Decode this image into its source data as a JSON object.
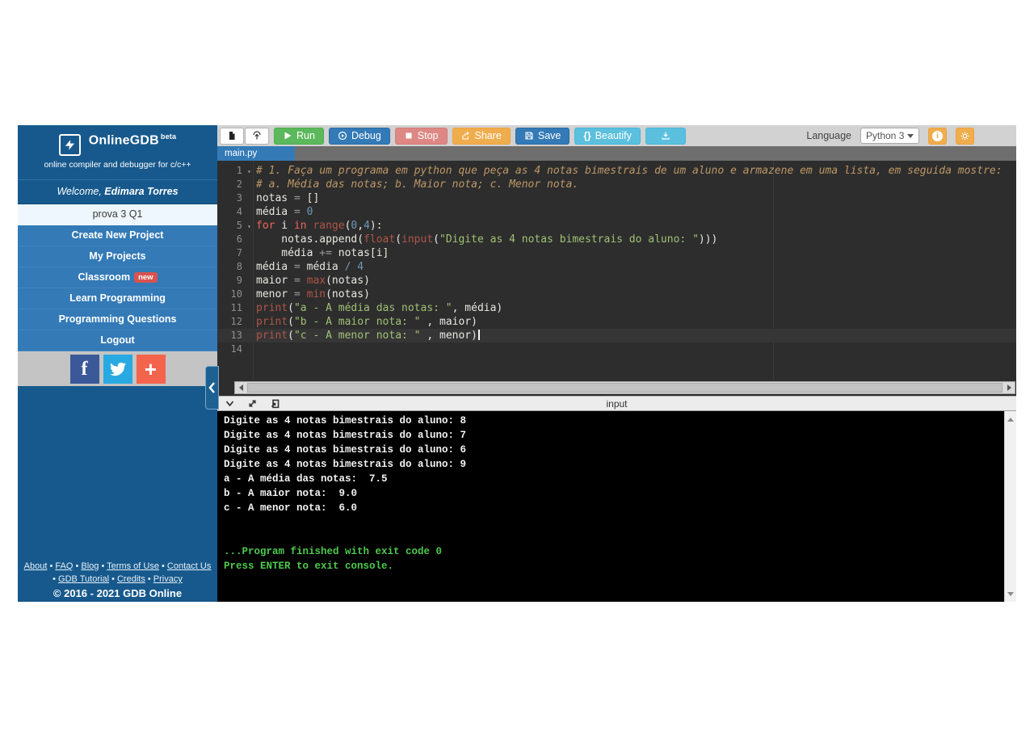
{
  "app": {
    "title": "OnlineGDB",
    "beta": "beta",
    "subtitle": "online compiler and debugger for c/c++"
  },
  "sidebar": {
    "welcome_prefix": "Welcome, ",
    "welcome_name": "Edimara Torres",
    "items": [
      {
        "label": "prova 3 Q1",
        "selected": true
      },
      {
        "label": "Create New Project"
      },
      {
        "label": "My Projects"
      },
      {
        "label": "Classroom",
        "badge": "new"
      },
      {
        "label": "Learn Programming"
      },
      {
        "label": "Programming Questions"
      },
      {
        "label": "Logout"
      }
    ],
    "social": [
      "facebook",
      "twitter",
      "google-plus"
    ],
    "footer_links_row1": [
      "About",
      "FAQ",
      "Blog",
      "Terms of Use",
      "Contact Us"
    ],
    "footer_links_row2": [
      "GDB Tutorial",
      "Credits",
      "Privacy"
    ],
    "copyright": "© 2016 - 2021 GDB Online"
  },
  "toolbar": {
    "run": "Run",
    "debug": "Debug",
    "stop": "Stop",
    "share": "Share",
    "save": "Save",
    "beautify_braces": "{}",
    "beautify": "Beautify",
    "language_label": "Language",
    "language_value": "Python 3"
  },
  "tab": {
    "name": "main.py"
  },
  "editor": {
    "lines": [
      {
        "n": 1,
        "fold": true,
        "tokens": [
          {
            "t": "# 1. Faça um programa em python que peça as 4 notas bimestrais de um aluno e armazene em uma lista, em seguida mostre:",
            "c": "c"
          }
        ]
      },
      {
        "n": 2,
        "tokens": [
          {
            "t": "# a. Média das notas; b. Maior nota; c. Menor nota.",
            "c": "c"
          }
        ]
      },
      {
        "n": 3,
        "tokens": [
          {
            "t": "notas ",
            "c": "v"
          },
          {
            "t": "= ",
            "c": "o"
          },
          {
            "t": "[]",
            "c": "v"
          }
        ]
      },
      {
        "n": 4,
        "tokens": [
          {
            "t": "média ",
            "c": "v"
          },
          {
            "t": "= ",
            "c": "o"
          },
          {
            "t": "0",
            "c": "n"
          }
        ]
      },
      {
        "n": 5,
        "fold": true,
        "tokens": [
          {
            "t": "for",
            "c": "k"
          },
          {
            "t": " i ",
            "c": "v"
          },
          {
            "t": "in",
            "c": "k"
          },
          {
            "t": " ",
            "c": "v"
          },
          {
            "t": "range",
            "c": "b"
          },
          {
            "t": "(",
            "c": "v"
          },
          {
            "t": "0",
            "c": "n"
          },
          {
            "t": ",",
            "c": "v"
          },
          {
            "t": "4",
            "c": "n"
          },
          {
            "t": "):",
            "c": "v"
          }
        ]
      },
      {
        "n": 6,
        "tokens": [
          {
            "t": "    notas.append(",
            "c": "v"
          },
          {
            "t": "float",
            "c": "b"
          },
          {
            "t": "(",
            "c": "v"
          },
          {
            "t": "input",
            "c": "b"
          },
          {
            "t": "(",
            "c": "v"
          },
          {
            "t": "\"Digite as 4 notas bimestrais do aluno: \"",
            "c": "s"
          },
          {
            "t": ")))",
            "c": "v"
          }
        ]
      },
      {
        "n": 7,
        "tokens": [
          {
            "t": "    média ",
            "c": "v"
          },
          {
            "t": "+= ",
            "c": "o"
          },
          {
            "t": "notas[i]",
            "c": "v"
          }
        ]
      },
      {
        "n": 8,
        "tokens": [
          {
            "t": "média ",
            "c": "v"
          },
          {
            "t": "= ",
            "c": "o"
          },
          {
            "t": "média ",
            "c": "v"
          },
          {
            "t": "/ ",
            "c": "n"
          },
          {
            "t": "4",
            "c": "n"
          }
        ]
      },
      {
        "n": 9,
        "tokens": [
          {
            "t": "maior ",
            "c": "v"
          },
          {
            "t": "= ",
            "c": "o"
          },
          {
            "t": "max",
            "c": "b"
          },
          {
            "t": "(notas)",
            "c": "v"
          }
        ]
      },
      {
        "n": 10,
        "tokens": [
          {
            "t": "menor ",
            "c": "v"
          },
          {
            "t": "= ",
            "c": "o"
          },
          {
            "t": "min",
            "c": "b"
          },
          {
            "t": "(notas)",
            "c": "v"
          }
        ]
      },
      {
        "n": 11,
        "tokens": [
          {
            "t": "print",
            "c": "b"
          },
          {
            "t": "(",
            "c": "v"
          },
          {
            "t": "\"a - A média das notas: \"",
            "c": "s"
          },
          {
            "t": ", média)",
            "c": "v"
          }
        ]
      },
      {
        "n": 12,
        "tokens": [
          {
            "t": "print",
            "c": "b"
          },
          {
            "t": "(",
            "c": "v"
          },
          {
            "t": "\"b - A maior nota: \"",
            "c": "s"
          },
          {
            "t": " , maior)",
            "c": "v"
          }
        ]
      },
      {
        "n": 13,
        "active": true,
        "cursor": true,
        "tokens": [
          {
            "t": "print",
            "c": "b"
          },
          {
            "t": "(",
            "c": "v"
          },
          {
            "t": "\"c - A menor nota: \"",
            "c": "s"
          },
          {
            "t": " , menor)",
            "c": "v"
          }
        ]
      },
      {
        "n": 14,
        "tokens": []
      }
    ]
  },
  "console": {
    "label": "input",
    "lines": [
      {
        "text": "Digite as 4 notas bimestrais do aluno: 8"
      },
      {
        "text": "Digite as 4 notas bimestrais do aluno: 7"
      },
      {
        "text": "Digite as 4 notas bimestrais do aluno: 6"
      },
      {
        "text": "Digite as 4 notas bimestrais do aluno: 9"
      },
      {
        "text": "a - A média das notas:  7.5"
      },
      {
        "text": "b - A maior nota:  9.0"
      },
      {
        "text": "c - A menor nota:  6.0"
      },
      {
        "text": ""
      },
      {
        "text": ""
      },
      {
        "text": "...Program finished with exit code 0",
        "color": "green"
      },
      {
        "text": "Press ENTER to exit console.",
        "color": "green"
      }
    ]
  },
  "colors": {
    "sidebar": "#17598C",
    "menu": "#337AB7",
    "selected_item": "#EEF7FD",
    "badge": "#D9534F",
    "run": "#5CB85C",
    "debug": "#337AB7",
    "stop": "#DD8884",
    "share": "#F0AD4E",
    "save": "#337AB7",
    "beautify": "#5BC0DE",
    "settings": "#F0AD4E",
    "tab": "#337AB7",
    "editor_bg": "#2D2D2D",
    "console_bg": "#000000",
    "console_green": "#4EC94E",
    "facebook": "#3B5998",
    "twitter": "#29A9E1",
    "plus": "#F4644D"
  }
}
